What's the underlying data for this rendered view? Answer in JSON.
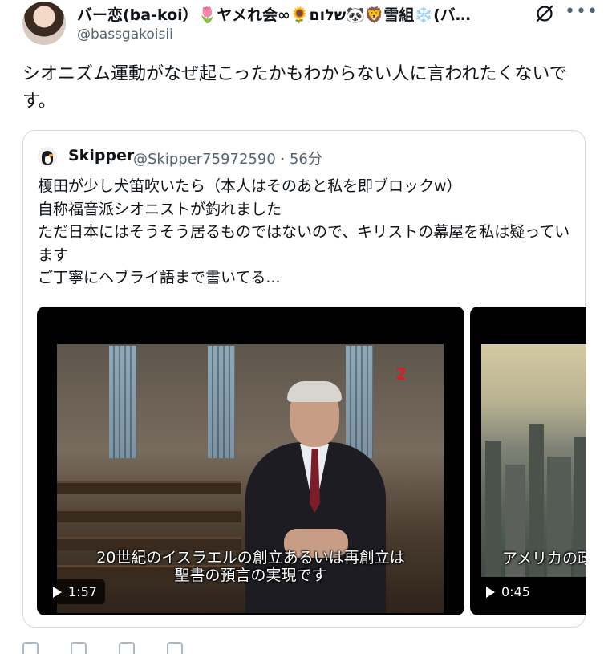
{
  "author": {
    "display_name": "バー恋(ba-koi）🌷ヤメれ会∞🌻שלום🐼🦁雪組❄️(バ…",
    "handle": "@bassgakoisii"
  },
  "tweet": {
    "text": "シオニズム運動がなぜ起こったかもわからない人に言われたくないです。"
  },
  "quote": {
    "name": "Skipper",
    "meta": "@Skipper75972590 · 56分",
    "lines": [
      "榎田が少し犬笛吹いたら（本人はそのあと私を即ブロックw）",
      "自称福音派シオニストが釣れました",
      "ただ日本にはそうそう居るものではないので、キリストの幕屋を私は疑っています",
      "ご丁寧にヘブライ語まで書いてる..."
    ]
  },
  "media": [
    {
      "subtitle_line1": "20世紀のイスラエルの創立あるいは再創立は",
      "subtitle_line2": "聖書の預言の実現です",
      "channel_logo": "2",
      "duration": "1:57"
    },
    {
      "subtitle": "アメリカの政",
      "duration": "0:45"
    }
  ],
  "icons": [
    "grok-icon",
    "more-icon",
    "play-icon"
  ]
}
